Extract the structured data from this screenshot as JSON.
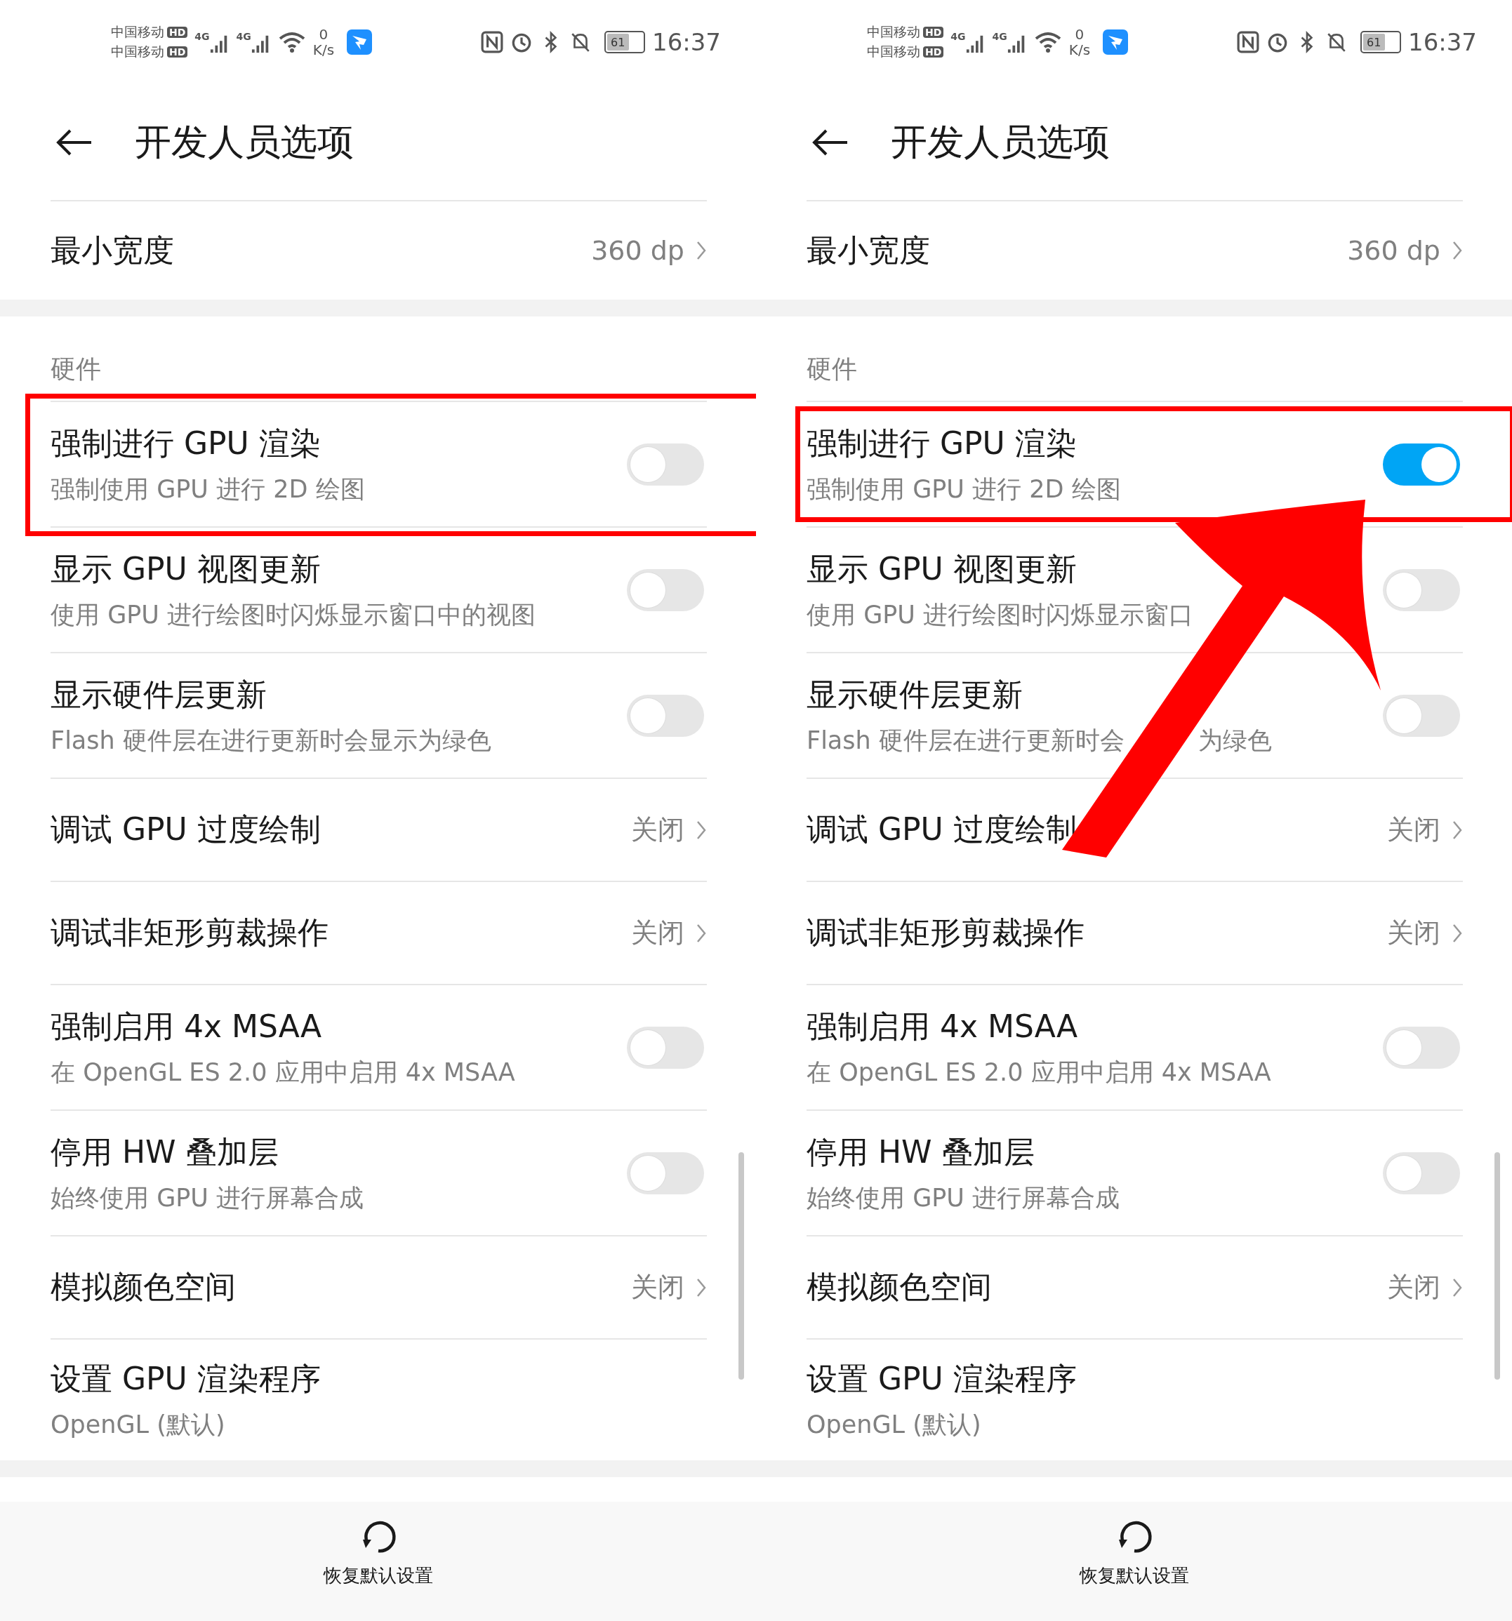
{
  "panels": [
    {
      "status_bar": {
        "carriers": [
          {
            "name": "中国移动",
            "badge": "HD"
          },
          {
            "name": "中国移动",
            "badge": "HD"
          }
        ],
        "networks": [
          "4G",
          "4G"
        ],
        "speed_value": "0",
        "speed_unit": "K/s",
        "battery": "61",
        "time": "16:37"
      },
      "header": {
        "title": "开发人员选项"
      },
      "items": [
        {
          "kind": "value",
          "title": "最小宽度",
          "value": "360 dp",
          "highlighted": false
        },
        {
          "kind": "section",
          "title": "硬件"
        },
        {
          "kind": "toggle",
          "title": "强制进行 GPU 渲染",
          "subtitle": "强制使用 GPU 进行 2D 绘图",
          "on": false,
          "highlighted": true
        },
        {
          "kind": "toggle",
          "title": "显示 GPU 视图更新",
          "subtitle": "使用 GPU 进行绘图时闪烁显示窗口中的视图",
          "on": false,
          "highlighted": false
        },
        {
          "kind": "toggle",
          "title": "显示硬件层更新",
          "subtitle": "Flash 硬件层在进行更新时会显示为绿色",
          "on": false,
          "highlighted": false
        },
        {
          "kind": "value",
          "title": "调试 GPU 过度绘制",
          "value": "关闭",
          "highlighted": false
        },
        {
          "kind": "value",
          "title": "调试非矩形剪裁操作",
          "value": "关闭",
          "highlighted": false
        },
        {
          "kind": "toggle",
          "title": "强制启用 4x MSAA",
          "subtitle": "在 OpenGL ES 2.0 应用中启用 4x MSAA",
          "on": false,
          "highlighted": false
        },
        {
          "kind": "toggle",
          "title": "停用 HW 叠加层",
          "subtitle": "始终使用 GPU 进行屏幕合成",
          "on": false,
          "highlighted": false
        },
        {
          "kind": "value",
          "title": "模拟颜色空间",
          "value": "关闭",
          "highlighted": false
        },
        {
          "kind": "text",
          "title": "设置 GPU 渲染程序",
          "subtitle": "OpenGL (默认)",
          "highlighted": false
        }
      ],
      "bottom_action": {
        "label": "恢复默认设置"
      }
    },
    {
      "status_bar": {
        "carriers": [
          {
            "name": "中国移动",
            "badge": "HD"
          },
          {
            "name": "中国移动",
            "badge": "HD"
          }
        ],
        "networks": [
          "4G",
          "4G"
        ],
        "speed_value": "0",
        "speed_unit": "K/s",
        "battery": "61",
        "time": "16:37"
      },
      "header": {
        "title": "开发人员选项"
      },
      "items": [
        {
          "kind": "value",
          "title": "最小宽度",
          "value": "360 dp",
          "highlighted": false
        },
        {
          "kind": "section",
          "title": "硬件"
        },
        {
          "kind": "toggle",
          "title": "强制进行 GPU 渲染",
          "subtitle": "强制使用 GPU 进行 2D 绘图",
          "on": true,
          "highlighted": true
        },
        {
          "kind": "toggle",
          "title": "显示 GPU 视图更新",
          "subtitle": "使用 GPU 进行绘图时闪烁显示窗口",
          "on": false,
          "highlighted": false
        },
        {
          "kind": "toggle",
          "title": "显示硬件层更新",
          "subtitle_parts": [
            "Flash 硬件层在进行更新时会",
            "为绿色"
          ],
          "on": false,
          "highlighted": false
        },
        {
          "kind": "value",
          "title": "调试 GPU 过度绘制",
          "value": "关闭",
          "highlighted": false
        },
        {
          "kind": "value",
          "title": "调试非矩形剪裁操作",
          "value": "关闭",
          "highlighted": false
        },
        {
          "kind": "toggle",
          "title": "强制启用 4x MSAA",
          "subtitle": "在 OpenGL ES 2.0 应用中启用 4x MSAA",
          "on": false,
          "highlighted": false
        },
        {
          "kind": "toggle",
          "title": "停用 HW 叠加层",
          "subtitle": "始终使用 GPU 进行屏幕合成",
          "on": false,
          "highlighted": false
        },
        {
          "kind": "value",
          "title": "模拟颜色空间",
          "value": "关闭",
          "highlighted": false
        },
        {
          "kind": "text",
          "title": "设置 GPU 渲染程序",
          "subtitle": "OpenGL (默认)",
          "highlighted": false
        }
      ],
      "bottom_action": {
        "label": "恢复默认设置"
      },
      "annotation_arrow": true
    }
  ]
}
